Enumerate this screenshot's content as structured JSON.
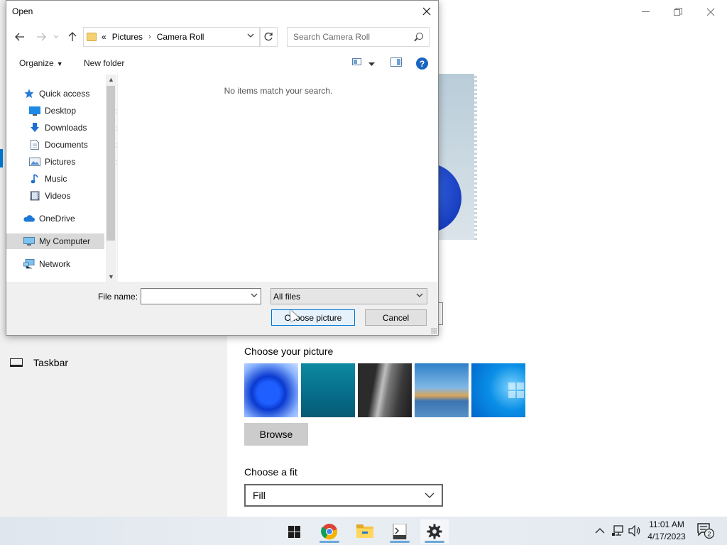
{
  "settings": {
    "sidebar": {
      "taskbar_label": "Taskbar"
    },
    "choose_picture_title": "Choose your picture",
    "browse_label": "Browse",
    "choose_fit_title": "Choose a fit",
    "fit_value": "Fill"
  },
  "dialog": {
    "title": "Open",
    "breadcrumb": {
      "overflow": "«",
      "parent": "Pictures",
      "current": "Camera Roll"
    },
    "search_placeholder": "Search Camera Roll",
    "organize_label": "Organize",
    "new_folder_label": "New folder",
    "help_label": "?",
    "nav_tree": [
      {
        "label": "Quick access",
        "icon": "star-icon"
      },
      {
        "label": "Desktop",
        "icon": "desktop-icon",
        "pinned": true
      },
      {
        "label": "Downloads",
        "icon": "download-icon",
        "pinned": true
      },
      {
        "label": "Documents",
        "icon": "document-icon",
        "pinned": true
      },
      {
        "label": "Pictures",
        "icon": "pictures-icon",
        "pinned": true
      },
      {
        "label": "Music",
        "icon": "music-icon"
      },
      {
        "label": "Videos",
        "icon": "video-icon"
      },
      {
        "label": "OneDrive",
        "icon": "cloud-icon"
      },
      {
        "label": "My Computer",
        "icon": "computer-icon",
        "selected": true
      },
      {
        "label": "Network",
        "icon": "network-icon"
      }
    ],
    "empty_message": "No items match your search.",
    "file_name_label": "File name:",
    "file_name_value": "",
    "file_type": "All files",
    "choose_button": "Choose picture",
    "cancel_button": "Cancel"
  },
  "taskbar": {
    "clock_time": "11:01 AM",
    "clock_date": "4/17/2023",
    "notification_count": "2"
  },
  "colors": {
    "accent": "#0078d4",
    "help": "#1a65c0"
  }
}
